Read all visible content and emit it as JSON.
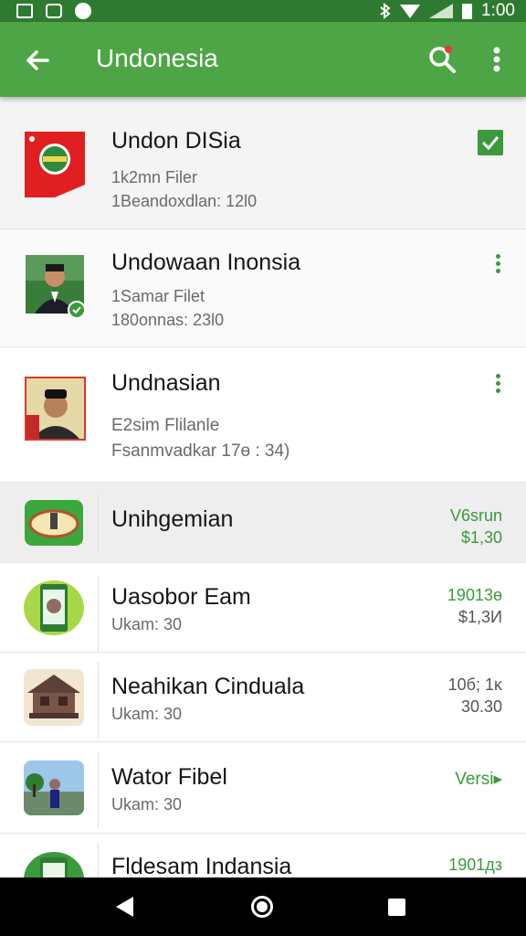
{
  "status_bar": {
    "time": "1:00"
  },
  "app_bar": {
    "title": "Undonesia",
    "icons": [
      "back-arrow-icon",
      "search-icon",
      "more-vert-icon"
    ]
  },
  "accent_color": "#4ea545",
  "items": [
    {
      "title": "Undon DISia",
      "line1": "1k2mn Filer",
      "line2": "1Beandoxdlan: 12l0",
      "action": "checkbox-checked"
    },
    {
      "title": "Undowaan Inonsia",
      "line1": "1Samar Filet",
      "line2": "180onnas: 23l0",
      "action": "more-vert"
    },
    {
      "title": "Undnasian",
      "line1": "E2sim Flilanle",
      "line2": "Fsanmvadkar 17ө : 34)",
      "action": "more-vert"
    },
    {
      "title": "Unihgemian",
      "right_top": "V6srun",
      "right_bottom": "$1,30"
    },
    {
      "title": "Uasobor Eam",
      "line1": "Ukam: 30",
      "right_top": "19013ө",
      "right_bottom": "$1,3И"
    },
    {
      "title": "Neahikan Cinduala",
      "line1": "Ukam: 30",
      "right_top": "10б; 1κ",
      "right_bottom": "30.30"
    },
    {
      "title": "Wator Fibel",
      "line1": "Ukam: 30",
      "right_top": "Versi▸"
    },
    {
      "title": "Fldesam Indansia",
      "right_top": "1901дз"
    }
  ]
}
